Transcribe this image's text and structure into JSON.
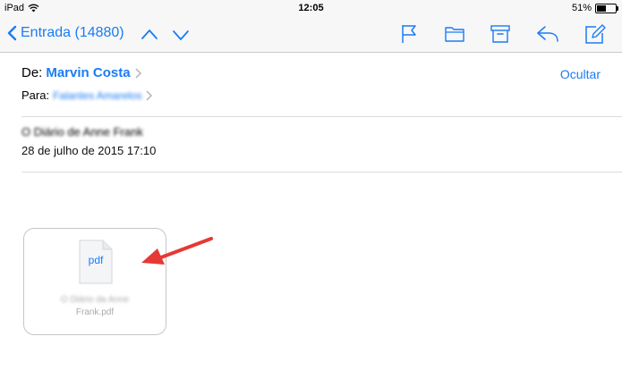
{
  "status_bar": {
    "device": "iPad",
    "time": "12:05",
    "battery": "51%",
    "battery_level": 0.51
  },
  "nav": {
    "back_label": "Entrada (14880)"
  },
  "icons": {
    "back": "chevron-left-icon",
    "prev": "chevron-up-icon",
    "next": "chevron-down-icon",
    "flag": "flag-icon",
    "folder": "folder-icon",
    "archive": "archive-icon",
    "reply": "reply-icon",
    "compose": "compose-icon",
    "wifi": "wifi-icon",
    "file": "pdf-file-icon"
  },
  "email": {
    "from_label": "De:",
    "from_name": "Marvin Costa",
    "to_label": "Para:",
    "to_name": "Falantes Amarelos",
    "hide_label": "Ocultar",
    "subject": "O Diário de Anne Frank",
    "date": "28 de julho de 2015 17:10"
  },
  "attachment": {
    "extension": "pdf",
    "name_line1": "O Diário da Anne",
    "name_line2": "Frank.pdf"
  },
  "colors": {
    "accent": "#1a7cf5",
    "annotation_arrow": "#e53935"
  }
}
